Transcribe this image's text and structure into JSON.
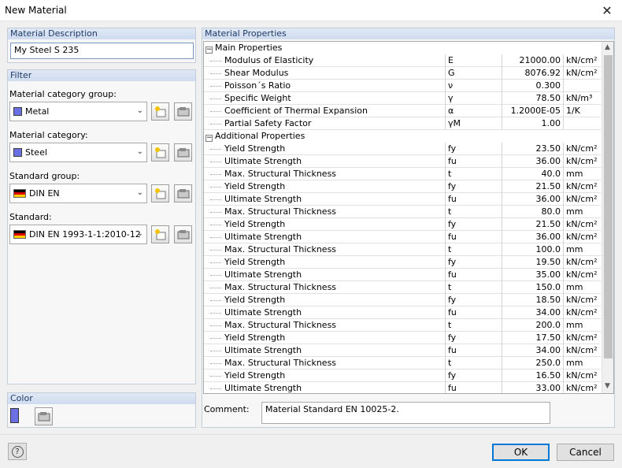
{
  "window": {
    "title": "New Material",
    "close_glyph": "✕"
  },
  "description": {
    "header": "Material Description",
    "value": "My Steel S 235"
  },
  "filter": {
    "header": "Filter",
    "category_group_label": "Material category group:",
    "category_group_value": "Metal",
    "category_label": "Material category:",
    "category_value": "Steel",
    "standard_group_label": "Standard group:",
    "standard_group_value": "DIN EN",
    "standard_label": "Standard:",
    "standard_value": "DIN EN 1993-1-1:2010-12"
  },
  "color": {
    "header": "Color",
    "swatch": "#6a6fe3"
  },
  "properties": {
    "header": "Material Properties",
    "main_label": "Main Properties",
    "additional_label": "Additional Properties",
    "main": [
      {
        "name": "Modulus of Elasticity",
        "sym": "E",
        "val": "21000.00",
        "unit": "kN/cm²"
      },
      {
        "name": "Shear Modulus",
        "sym": "G",
        "val": "8076.92",
        "unit": "kN/cm²"
      },
      {
        "name": "Poisson´s Ratio",
        "sym": "ν",
        "val": "0.300",
        "unit": ""
      },
      {
        "name": "Specific Weight",
        "sym": "γ",
        "val": "78.50",
        "unit": "kN/m³"
      },
      {
        "name": "Coefficient of Thermal Expansion",
        "sym": "α",
        "val": "1.2000E-05",
        "unit": "1/K"
      },
      {
        "name": "Partial Safety Factor",
        "sym": "γM",
        "val": "1.00",
        "unit": ""
      }
    ],
    "additional": [
      {
        "name": "Yield Strength",
        "sym": "fy",
        "val": "23.50",
        "unit": "kN/cm²"
      },
      {
        "name": "Ultimate Strength",
        "sym": "fu",
        "val": "36.00",
        "unit": "kN/cm²"
      },
      {
        "name": "Max. Structural Thickness",
        "sym": "t",
        "val": "40.0",
        "unit": "mm"
      },
      {
        "name": "Yield Strength",
        "sym": "fy",
        "val": "21.50",
        "unit": "kN/cm²"
      },
      {
        "name": "Ultimate Strength",
        "sym": "fu",
        "val": "36.00",
        "unit": "kN/cm²"
      },
      {
        "name": "Max. Structural Thickness",
        "sym": "t",
        "val": "80.0",
        "unit": "mm"
      },
      {
        "name": "Yield Strength",
        "sym": "fy",
        "val": "21.50",
        "unit": "kN/cm²"
      },
      {
        "name": "Ultimate Strength",
        "sym": "fu",
        "val": "36.00",
        "unit": "kN/cm²"
      },
      {
        "name": "Max. Structural Thickness",
        "sym": "t",
        "val": "100.0",
        "unit": "mm"
      },
      {
        "name": "Yield Strength",
        "sym": "fy",
        "val": "19.50",
        "unit": "kN/cm²"
      },
      {
        "name": "Ultimate Strength",
        "sym": "fu",
        "val": "35.00",
        "unit": "kN/cm²"
      },
      {
        "name": "Max. Structural Thickness",
        "sym": "t",
        "val": "150.0",
        "unit": "mm"
      },
      {
        "name": "Yield Strength",
        "sym": "fy",
        "val": "18.50",
        "unit": "kN/cm²"
      },
      {
        "name": "Ultimate Strength",
        "sym": "fu",
        "val": "34.00",
        "unit": "kN/cm²"
      },
      {
        "name": "Max. Structural Thickness",
        "sym": "t",
        "val": "200.0",
        "unit": "mm"
      },
      {
        "name": "Yield Strength",
        "sym": "fy",
        "val": "17.50",
        "unit": "kN/cm²"
      },
      {
        "name": "Ultimate Strength",
        "sym": "fu",
        "val": "34.00",
        "unit": "kN/cm²"
      },
      {
        "name": "Max. Structural Thickness",
        "sym": "t",
        "val": "250.0",
        "unit": "mm"
      },
      {
        "name": "Yield Strength",
        "sym": "fy",
        "val": "16.50",
        "unit": "kN/cm²"
      },
      {
        "name": "Ultimate Strength",
        "sym": "fu",
        "val": "33.00",
        "unit": "kN/cm²"
      }
    ]
  },
  "comment": {
    "label": "Comment:",
    "value": "Material Standard EN 10025-2."
  },
  "buttons": {
    "help_glyph": "?",
    "ok": "OK",
    "cancel": "Cancel"
  }
}
